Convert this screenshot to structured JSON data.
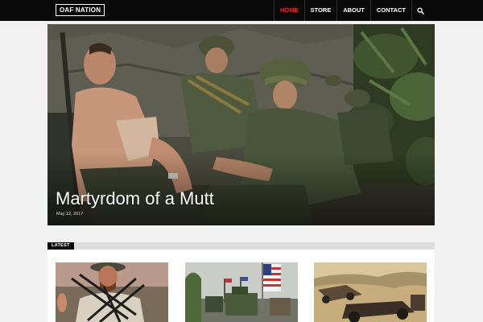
{
  "header": {
    "logo_text": "OAF NATION",
    "nav": {
      "home": "HOME",
      "store": "STORE",
      "about": "ABOUT",
      "contact": "CONTACT"
    },
    "active_color": "#e03131",
    "search_icon": "search-icon"
  },
  "featured": {
    "title": "Martyrdom of a Mutt",
    "date": "May 12, 2017"
  },
  "latest": {
    "label": "LATEST",
    "posts": [
      {
        "image": "soldier-with-rifles"
      },
      {
        "image": "military-convoy-with-flags"
      },
      {
        "image": "desert-vehicles"
      }
    ]
  }
}
